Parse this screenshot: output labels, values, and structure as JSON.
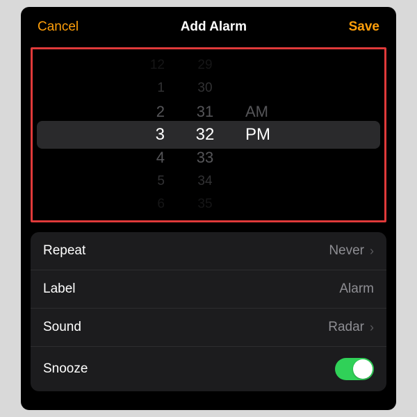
{
  "header": {
    "cancel": "Cancel",
    "title": "Add Alarm",
    "save": "Save"
  },
  "picker": {
    "hours": [
      "12",
      "1",
      "2",
      "3",
      "4",
      "5",
      "6"
    ],
    "minutes": [
      "29",
      "30",
      "31",
      "32",
      "33",
      "34",
      "35"
    ],
    "ampm": [
      "",
      "",
      "AM",
      "PM",
      "",
      "",
      ""
    ],
    "selected_index": 3,
    "opacity": [
      "0.15",
      "0.35",
      "0.6",
      "1",
      "0.6",
      "0.35",
      "0.15"
    ],
    "color_selected": "#ffffff",
    "color_unselected": "#8e8e93"
  },
  "settings": {
    "repeat": {
      "label": "Repeat",
      "value": "Never"
    },
    "label": {
      "label": "Label",
      "value": "Alarm"
    },
    "sound": {
      "label": "Sound",
      "value": "Radar"
    },
    "snooze": {
      "label": "Snooze",
      "on": true
    }
  },
  "colors": {
    "accent": "#ff9f0a",
    "toggle_on": "#30d158",
    "highlight_box": "#e03a3a"
  }
}
